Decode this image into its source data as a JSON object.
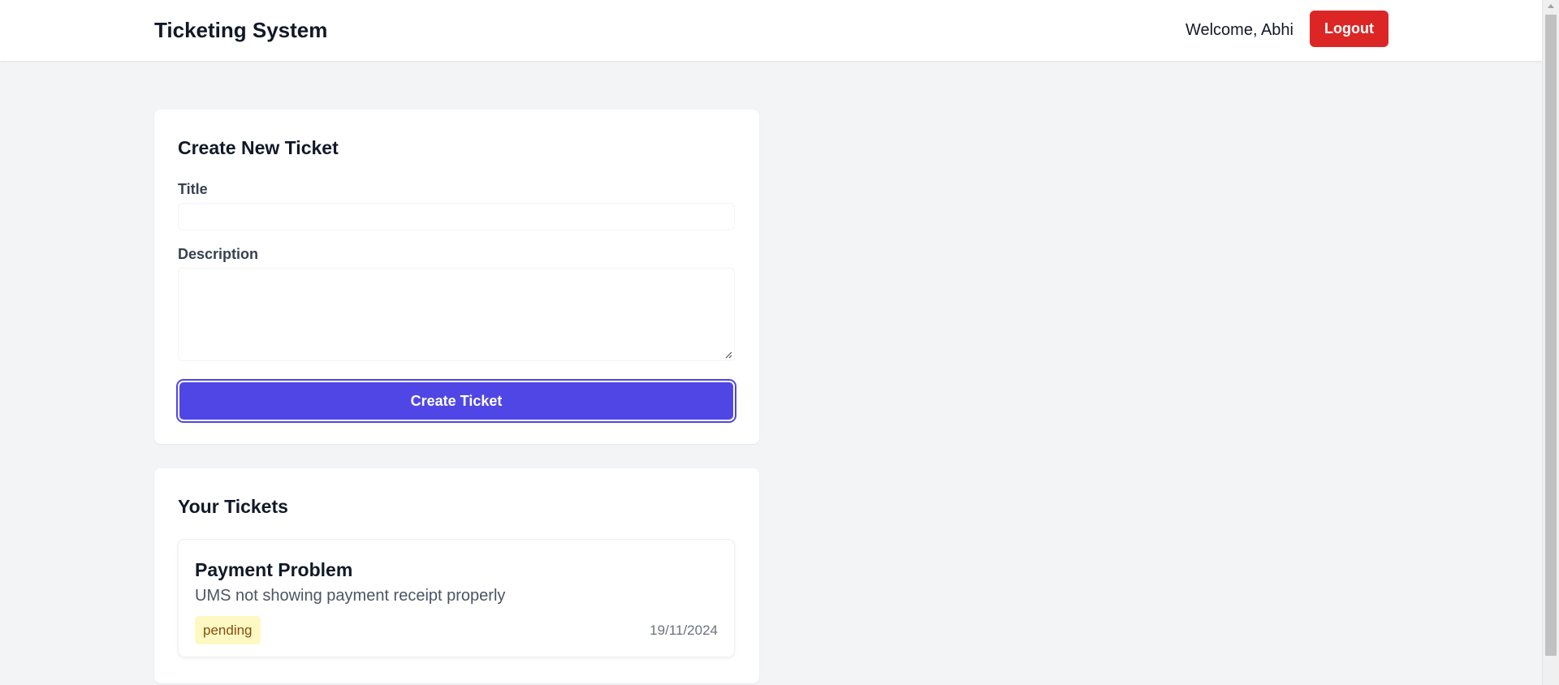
{
  "header": {
    "brand": "Ticketing System",
    "welcome": "Welcome, Abhi",
    "logout_label": "Logout"
  },
  "create_form": {
    "heading": "Create New Ticket",
    "title_label": "Title",
    "title_value": "",
    "description_label": "Description",
    "description_value": "",
    "submit_label": "Create Ticket"
  },
  "tickets_section": {
    "heading": "Your Tickets",
    "tickets": [
      {
        "title": "Payment Problem",
        "description": "UMS not showing payment receipt properly",
        "status": "pending",
        "date": "19/11/2024"
      }
    ]
  },
  "colors": {
    "primary": "#4f46e5",
    "danger": "#dc2626",
    "pending_bg": "#fef9c3",
    "pending_text": "#854d0e",
    "background": "#f3f4f6"
  },
  "icons": {
    "resize_handle": "resize-handle-icon",
    "scroll_up": "chevron-up-icon"
  }
}
